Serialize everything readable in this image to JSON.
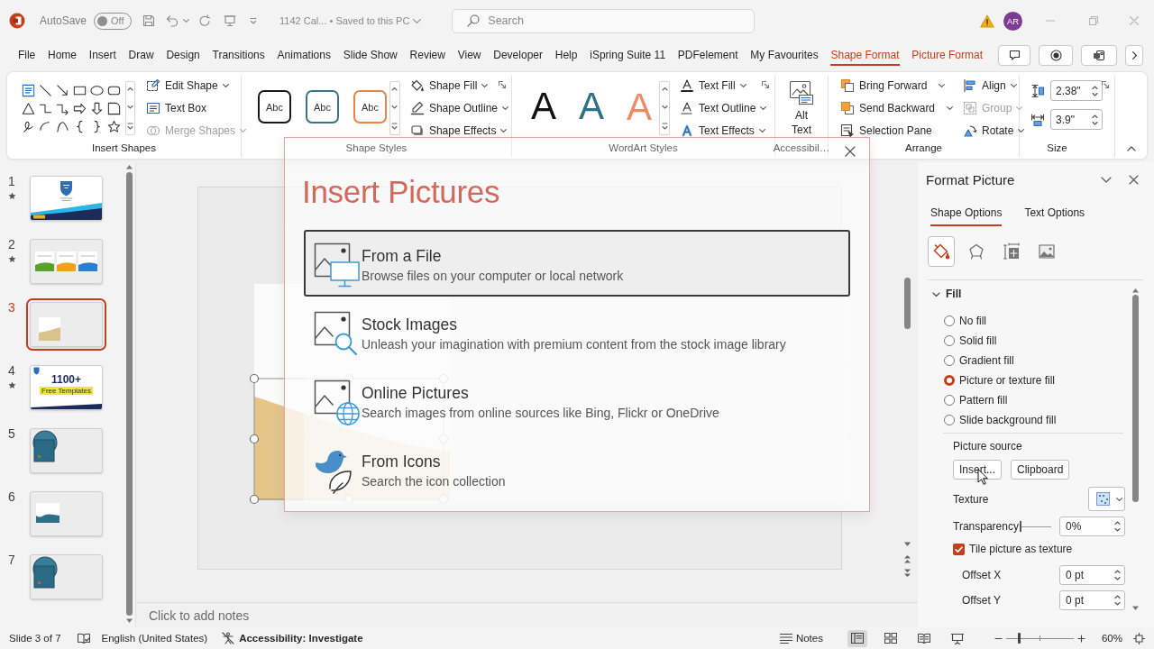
{
  "title_bar": {
    "autosave_label": "AutoSave",
    "autosave": {
      "label": "Off",
      "on": false
    },
    "document_title": "1142 Cal... • Saved to this PC",
    "search": {
      "placeholder": "Search"
    },
    "account_initials": "AR"
  },
  "ribbon_tabs": [
    {
      "label": "File",
      "selected": false,
      "contextual": false
    },
    {
      "label": "Home",
      "selected": false,
      "contextual": false
    },
    {
      "label": "Insert",
      "selected": false,
      "contextual": false
    },
    {
      "label": "Draw",
      "selected": false,
      "contextual": false
    },
    {
      "label": "Design",
      "selected": false,
      "contextual": false
    },
    {
      "label": "Transitions",
      "selected": false,
      "contextual": false
    },
    {
      "label": "Animations",
      "selected": false,
      "contextual": false
    },
    {
      "label": "Slide Show",
      "selected": false,
      "contextual": false
    },
    {
      "label": "Review",
      "selected": false,
      "contextual": false
    },
    {
      "label": "View",
      "selected": false,
      "contextual": false
    },
    {
      "label": "Developer",
      "selected": false,
      "contextual": false
    },
    {
      "label": "Help",
      "selected": false,
      "contextual": false
    },
    {
      "label": "iSpring Suite 11",
      "selected": false,
      "contextual": false
    },
    {
      "label": "PDFelement",
      "selected": false,
      "contextual": false
    },
    {
      "label": "My Favourites",
      "selected": false,
      "contextual": false
    },
    {
      "label": "Shape Format",
      "selected": true,
      "contextual": true
    },
    {
      "label": "Picture Format",
      "selected": false,
      "contextual": true
    }
  ],
  "ribbon": {
    "groups": [
      {
        "kind": "insert_shapes",
        "label": "Insert Shapes",
        "commands": [
          {
            "label": "Edit Shape",
            "disabled": false,
            "dropdown": true
          },
          {
            "label": "Text Box",
            "disabled": false,
            "dropdown": false
          },
          {
            "label": "Merge Shapes",
            "disabled": true,
            "dropdown": true
          }
        ]
      },
      {
        "kind": "shape_styles",
        "label": "Shape Styles",
        "styles": [
          {
            "label": "Abc",
            "color": "#1a1a1a"
          },
          {
            "label": "Abc",
            "color": "#3a7489"
          },
          {
            "label": "Abc",
            "color": "#e8834a"
          }
        ],
        "commands": [
          {
            "label": "Shape Fill",
            "disabled": false,
            "dropdown": true
          },
          {
            "label": "Shape Outline",
            "disabled": false,
            "dropdown": true
          },
          {
            "label": "Shape Effects",
            "disabled": false,
            "dropdown": true
          }
        ]
      },
      {
        "kind": "wordart_styles",
        "label": "WordArt Styles",
        "styles": [
          {
            "label": "A",
            "color": "#111111",
            "kind": "solid"
          },
          {
            "label": "A",
            "color": "#2f6f88",
            "kind": "solid"
          },
          {
            "label": "A",
            "color": "#f08a62",
            "kind": "outline"
          }
        ],
        "commands": [
          {
            "label": "Text Fill",
            "disabled": false,
            "dropdown": true
          },
          {
            "label": "Text Outline",
            "disabled": false,
            "dropdown": true
          },
          {
            "label": "Text Effects",
            "disabled": false,
            "dropdown": true
          }
        ]
      },
      {
        "kind": "accessibility",
        "label": "Accessibil…",
        "commands": [
          {
            "label": "Alt Text",
            "disabled": false
          }
        ]
      },
      {
        "kind": "arrange",
        "label": "Arrange",
        "commands": [
          {
            "label": "Bring Forward",
            "disabled": false,
            "dropdown": true
          },
          {
            "label": "Send Backward",
            "disabled": false,
            "dropdown": true
          },
          {
            "label": "Selection Pane",
            "disabled": false,
            "dropdown": false
          },
          {
            "label": "Align",
            "disabled": false,
            "dropdown": true
          },
          {
            "label": "Group",
            "disabled": true,
            "dropdown": true
          },
          {
            "label": "Rotate",
            "disabled": false,
            "dropdown": true
          }
        ]
      },
      {
        "kind": "size",
        "label": "Size",
        "fields": [
          {
            "kind": "height",
            "value": "2.38\""
          },
          {
            "kind": "width",
            "value": "3.9\""
          }
        ]
      }
    ]
  },
  "slides": [
    {
      "number": "1",
      "starred": true,
      "selected": false,
      "kind": "title"
    },
    {
      "number": "2",
      "starred": true,
      "selected": false,
      "kind": "cards"
    },
    {
      "number": "3",
      "starred": false,
      "selected": true,
      "kind": "bubble"
    },
    {
      "number": "4",
      "starred": true,
      "selected": false,
      "kind": "promo",
      "heading": "1100+",
      "banner": "Free Templates"
    },
    {
      "number": "5",
      "starred": false,
      "selected": false,
      "kind": "circle"
    },
    {
      "number": "6",
      "starred": false,
      "selected": false,
      "kind": "bubble_blue"
    },
    {
      "number": "7",
      "starred": false,
      "selected": false,
      "kind": "circle"
    }
  ],
  "editor": {
    "notes_placeholder": "Click to add notes"
  },
  "insert_pictures_dialog": {
    "title": "Insert Pictures",
    "options": [
      {
        "kind": "file",
        "title": "From a File",
        "description": "Browse files on your computer or local network",
        "selected": true
      },
      {
        "kind": "stock",
        "title": "Stock Images",
        "description": "Unleash your imagination with premium content from the stock image library",
        "selected": false
      },
      {
        "kind": "online",
        "title": "Online Pictures",
        "description": "Search images from online sources like Bing, Flickr or OneDrive",
        "selected": false
      },
      {
        "kind": "icons",
        "title": "From Icons",
        "description": "Search the icon collection",
        "selected": false
      }
    ]
  },
  "format_pane": {
    "title": "Format Picture",
    "tabs": [
      {
        "label": "Shape Options",
        "selected": true
      },
      {
        "label": "Text Options",
        "selected": false
      }
    ],
    "icon_tabs": [
      {
        "kind": "fill_line",
        "selected": true
      },
      {
        "kind": "effects",
        "selected": false
      },
      {
        "kind": "size_properties",
        "selected": false
      },
      {
        "kind": "picture",
        "selected": false
      }
    ],
    "fill": {
      "label": "Fill",
      "expanded": true,
      "options": [
        {
          "label": "No fill",
          "selected": false
        },
        {
          "label": "Solid fill",
          "selected": false
        },
        {
          "label": "Gradient fill",
          "selected": false
        },
        {
          "label": "Picture or texture fill",
          "selected": true
        },
        {
          "label": "Pattern fill",
          "selected": false
        },
        {
          "label": "Slide background fill",
          "selected": false
        }
      ],
      "picture_source_label": "Picture source",
      "source_buttons": [
        "Insert...",
        "Clipboard"
      ],
      "texture_label": "Texture",
      "transparency": {
        "label": "Transparency",
        "level": 0,
        "value": "0%"
      },
      "tile": {
        "label": "Tile picture as texture",
        "checked": true
      },
      "offsets": [
        {
          "label": "Offset X",
          "value": "0 pt"
        },
        {
          "label": "Offset Y",
          "value": "0 pt"
        }
      ]
    }
  },
  "status_bar": {
    "slide_position": "Slide 3 of 7",
    "language": "English (United States)",
    "accessibility": "Accessibility: Investigate",
    "notes_button": "Notes",
    "views": [
      {
        "kind": "normal",
        "selected": true
      },
      {
        "kind": "slide_sorter",
        "selected": false
      },
      {
        "kind": "reading",
        "selected": false
      },
      {
        "kind": "slide_show",
        "selected": false
      }
    ],
    "zoom": {
      "level": 0.2,
      "value": "60%"
    }
  }
}
